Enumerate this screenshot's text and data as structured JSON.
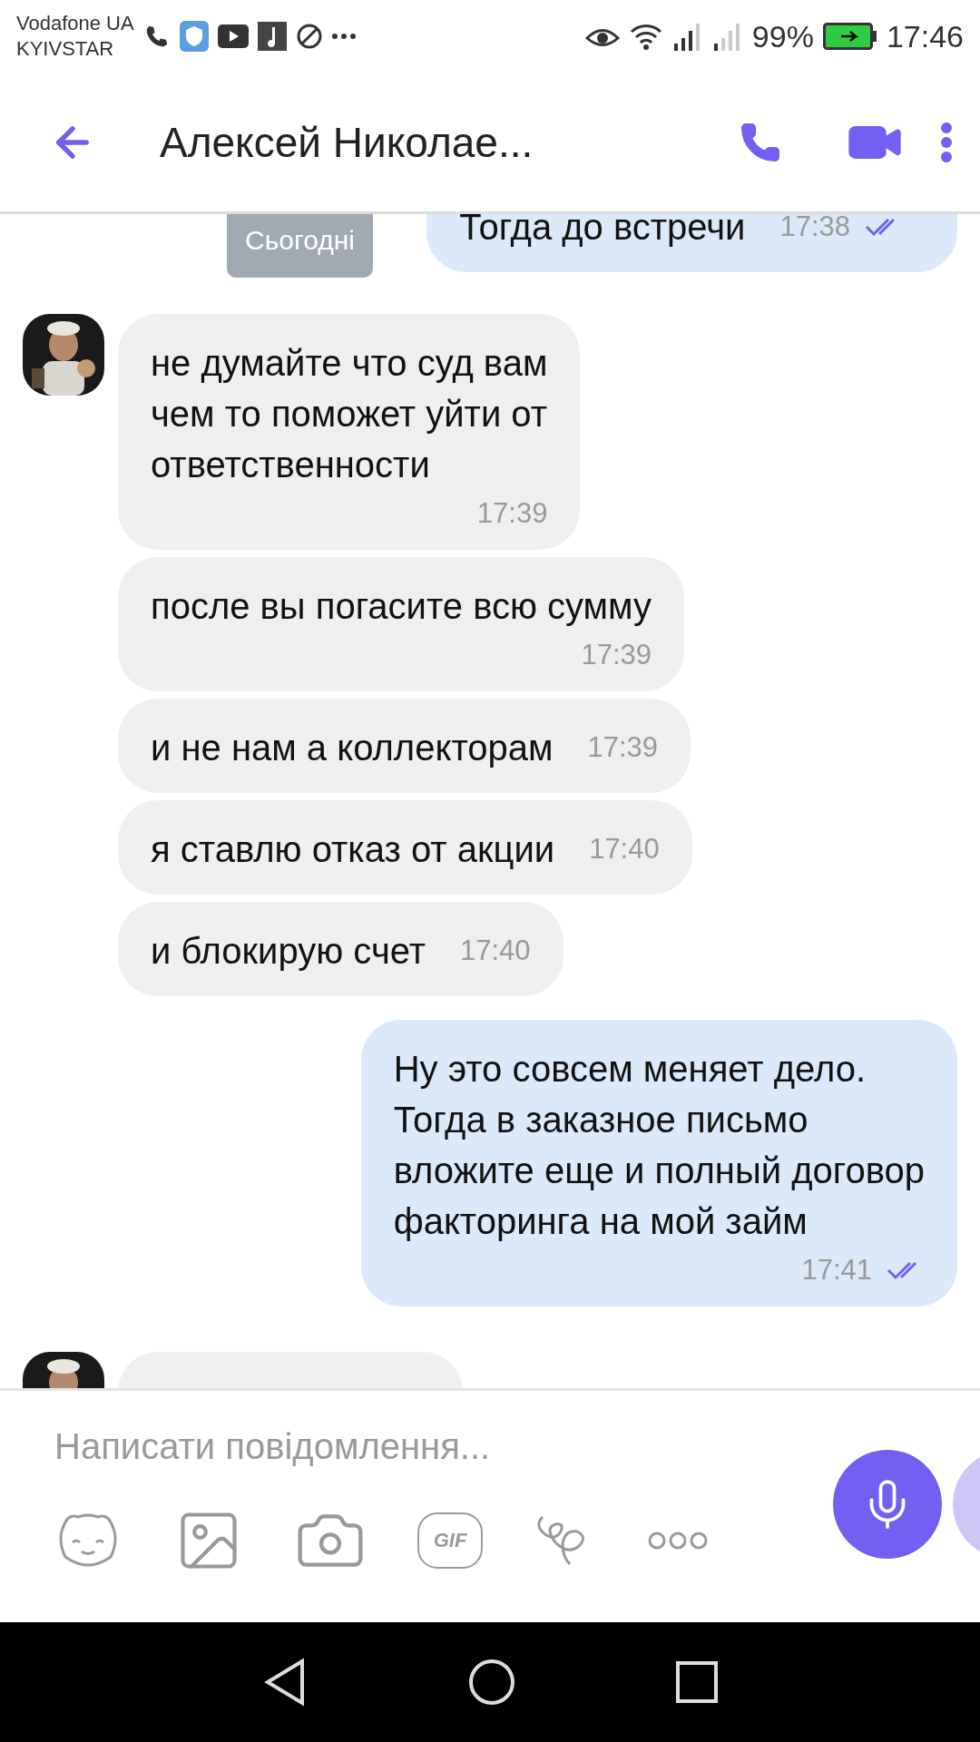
{
  "status_bar": {
    "carriers": [
      "Vodafone UA",
      "KYIVSTAR"
    ],
    "battery_text": "99%",
    "time": "17:46"
  },
  "header": {
    "title": "Алексей Николае..."
  },
  "date_chip": "Сьогодні",
  "messages": [
    {
      "outgoing": true,
      "text": "Тогда до встречи",
      "time": "17:38",
      "read": true
    },
    {
      "outgoing": false,
      "text": "не думайте что суд вам\nчем то поможет уйти от\nответственности",
      "time": "17:39",
      "avatar": true
    },
    {
      "outgoing": false,
      "text": "после вы погасите всю сумму",
      "time": "17:39",
      "avatar": false
    },
    {
      "outgoing": false,
      "text": "и не нам а коллекторам",
      "time": "17:39",
      "avatar": false
    },
    {
      "outgoing": false,
      "text": "я ставлю отказ от акции",
      "time": "17:40",
      "avatar": false
    },
    {
      "outgoing": false,
      "text": "и блокирую счет",
      "time": "17:40",
      "avatar": false
    },
    {
      "outgoing": true,
      "text": "Ну это совсем меняет дело.\nТогда в заказное письмо\nвложите еще и полный договор\nфакторинга на мой займ",
      "time": "17:41",
      "read": true
    },
    {
      "outgoing": false,
      "avatar": true
    }
  ],
  "composer": {
    "placeholder": "Написати повідомлення...",
    "gif_label": "GIF"
  }
}
